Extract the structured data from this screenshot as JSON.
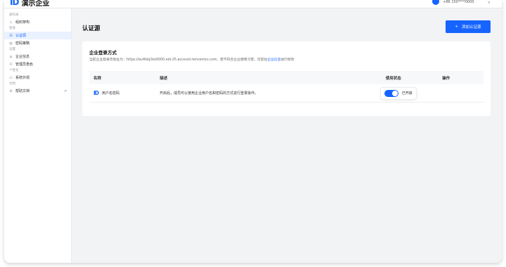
{
  "header": {
    "logo_mark": "ID",
    "title": "演示企业",
    "phone": "+86 150****0000",
    "chevron": "∨"
  },
  "sidebar": {
    "sections": [
      {
        "label": "通讯录",
        "items": [
          {
            "label": "组织架构",
            "icon": "org-icon",
            "glyph": "⛬"
          }
        ]
      },
      {
        "label": "登录",
        "items": [
          {
            "label": "认证源",
            "icon": "lock-icon",
            "glyph": "⊡",
            "active": true
          },
          {
            "label": "密码策略",
            "icon": "key-icon",
            "glyph": "◎"
          }
        ]
      },
      {
        "label": "设置",
        "items": [
          {
            "label": "企业信息",
            "icon": "building-icon",
            "glyph": "⌂"
          },
          {
            "label": "管理员角色",
            "icon": "admin-icon",
            "glyph": "⚇"
          }
        ]
      },
      {
        "label": "个性化",
        "items": [
          {
            "label": "系统外观",
            "icon": "monitor-icon",
            "glyph": "▭"
          }
        ]
      },
      {
        "label": "文档",
        "items": [
          {
            "label": "帮助文档",
            "icon": "help-icon",
            "glyph": "⊙",
            "external": "↗"
          }
        ]
      }
    ]
  },
  "main": {
    "title": "认证源",
    "add_button": {
      "icon": "+",
      "label": "添加认证源"
    },
    "card": {
      "title": "企业登录方式",
      "desc_prefix": "当前企业登录页地址为：https://eu4ldq2ko0000.eid-25.account.tencentcs.com，若不符合企业使用习惯，可前往",
      "desc_link": "企业信息",
      "desc_suffix": "进行修改",
      "columns": [
        "名称",
        "描述",
        "使用状态",
        "操作"
      ],
      "rows": [
        {
          "icon_text": "ID",
          "name": "用户名密码",
          "description": "开启后，成员可以使用企业用户名和密码的方式进行登录操作。",
          "status": "已开启",
          "enabled": true
        }
      ]
    }
  },
  "colors": {
    "accent": "#1664ff",
    "background": "#f2f3f5"
  }
}
